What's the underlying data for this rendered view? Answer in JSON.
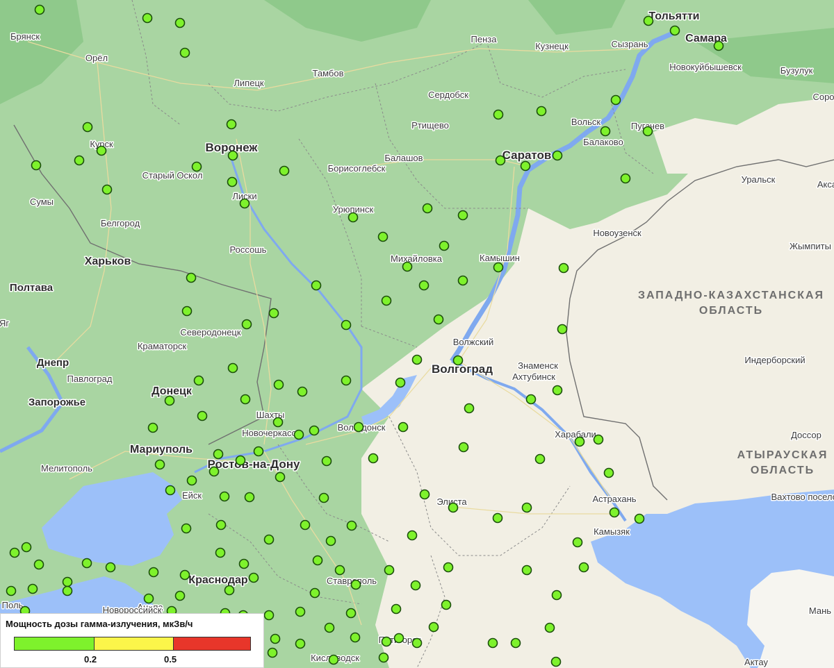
{
  "map": {
    "colors": {
      "land_steppe": "#a9d5a2",
      "land_desert": "#f2efe4",
      "water": "#9cc0f9",
      "marker_fill": "#7ef22c",
      "marker_stroke": "#1c4f0c"
    },
    "cities_major": [
      "Воронеж",
      "Саратов",
      "Волгоград",
      "Харьков",
      "Донецк",
      "Ростов-на-Дону",
      "Краснодар",
      "Самара",
      "Тольятти",
      "Мариуполь",
      "Запорожье",
      "Днепр",
      "Полтава"
    ],
    "cities_minor": [
      "Брянск",
      "Орёл",
      "Липецк",
      "Тамбов",
      "Пенза",
      "Кузнецк",
      "Сызрань",
      "Новокуйбышевск",
      "Бузулук",
      "Соро",
      "Курск",
      "Сердобск",
      "Ртищево",
      "Вольск",
      "Пугачев",
      "Балаково",
      "Балашов",
      "Борисоглебск",
      "Старый Оскол",
      "Сумы",
      "Лиски",
      "Уральск",
      "Акса",
      "Белгород",
      "Урюпинск",
      "Новоузенск",
      "Жымпиты",
      "Россошь",
      "Михайловка",
      "Камышин",
      "Северодонецк",
      "Краматорск",
      "Волжский",
      "Павлоград",
      "Знаменск",
      "Ахтубинск",
      "Индерборский",
      "Шахты",
      "Новочеркасск",
      "Волгодонск",
      "Харабали",
      "Доссор",
      "Мелитополь",
      "Ейск",
      "Элиста",
      "Астрахань",
      "Вахтово поселок Тенг",
      "Камызяк",
      "Анапа",
      "Новороссийск",
      "Ставрополь",
      "Пятигорск",
      "Кисловодск",
      "Актау",
      "Мань",
      "Яг",
      "Поль"
    ],
    "regions": [
      "ЗАПАДНО-КАЗАХСТАНСКАЯ ОБЛАСТЬ",
      "АТЫРАУСКАЯ ОБЛАСТЬ"
    ]
  },
  "legend": {
    "title": "Мощность дозы гамма-излучения, мкЗв/ч",
    "ticks": [
      "0.2",
      "0.5"
    ],
    "segments": [
      {
        "color": "#7ef22c",
        "from": 0,
        "to": 0.2
      },
      {
        "color": "#fbf54a",
        "from": 0.2,
        "to": 0.5
      },
      {
        "color": "#e8362a",
        "from": 0.5,
        "to": 0.8
      }
    ]
  },
  "stations_legend_value": "< 0.2"
}
